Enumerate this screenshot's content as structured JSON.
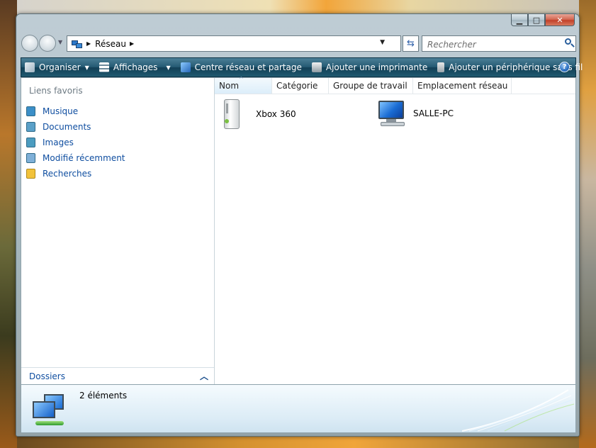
{
  "window": {
    "controls": {
      "minimize": "▁",
      "maximize": "□",
      "close": "✕"
    }
  },
  "address_bar": {
    "crumbs": [
      "Réseau"
    ],
    "separator": "▶"
  },
  "search": {
    "placeholder": "Rechercher"
  },
  "toolbar": {
    "items": [
      {
        "label": "Organiser",
        "icon": "organize-icon",
        "has_dropdown": true
      },
      {
        "label": "Affichages",
        "icon": "views-icon",
        "has_dropdown": true
      },
      {
        "label": "Centre réseau et partage",
        "icon": "network-center-icon",
        "has_dropdown": false
      },
      {
        "label": "Ajouter une imprimante",
        "icon": "printer-icon",
        "has_dropdown": false
      },
      {
        "label": "Ajouter un périphérique sans fil",
        "icon": "wireless-device-icon",
        "has_dropdown": false
      }
    ],
    "help": "?"
  },
  "nav_pane": {
    "favorites_title": "Liens favoris",
    "favorites": [
      {
        "label": "Musique",
        "icon": "music-icon",
        "color": "#3b8fc8"
      },
      {
        "label": "Documents",
        "icon": "documents-icon",
        "color": "#5aa0c8"
      },
      {
        "label": "Images",
        "icon": "pictures-icon",
        "color": "#4b9cc0"
      },
      {
        "label": "Modifié récemment",
        "icon": "recent-icon",
        "color": "#7fb0d8"
      },
      {
        "label": "Recherches",
        "icon": "searches-folder-icon",
        "color": "#f2c23a"
      }
    ],
    "folders_label": "Dossiers"
  },
  "list": {
    "columns": [
      "Nom",
      "Catégorie",
      "Groupe de travail",
      "Emplacement réseau"
    ],
    "sorted_column": "Nom",
    "items": [
      {
        "name": "Xbox 360",
        "icon": "xbox-360-icon"
      },
      {
        "name": "SALLE-PC",
        "icon": "computer-icon"
      }
    ]
  },
  "details": {
    "count_text": "2 éléments"
  },
  "colors": {
    "toolbar": "#1f5a70",
    "link": "#0f4ea0",
    "muted": "#6d7a83"
  }
}
